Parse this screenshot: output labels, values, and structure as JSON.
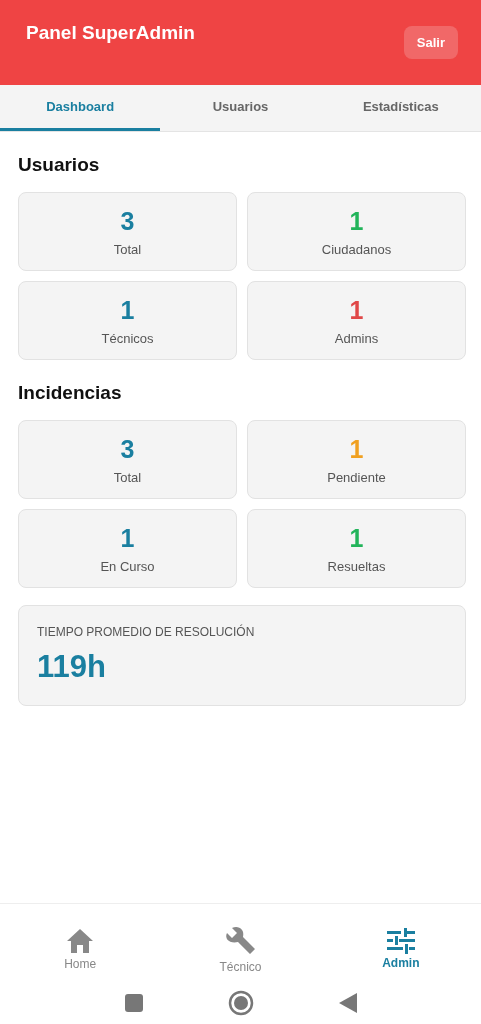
{
  "header": {
    "title": "Panel SuperAdmin",
    "button": "Salir"
  },
  "tabs": [
    {
      "label": "Dashboard",
      "selected": true
    },
    {
      "label": "Usuarios",
      "selected": false
    },
    {
      "label": "Estadísticas",
      "selected": false
    }
  ],
  "sections": [
    {
      "title": "Usuarios",
      "stats": [
        {
          "value": "3",
          "label": "Total",
          "color": "#1a7fa0"
        },
        {
          "value": "1",
          "label": "Ciudadanos",
          "color": "#22b45a"
        },
        {
          "value": "1",
          "label": "Técnicos",
          "color": "#1a7fa0"
        },
        {
          "value": "1",
          "label": "Admins",
          "color": "#e04848"
        }
      ]
    },
    {
      "title": "Incidencias",
      "stats": [
        {
          "value": "3",
          "label": "Total",
          "color": "#1a7fa0"
        },
        {
          "value": "1",
          "label": "Pendiente",
          "color": "#f0a020"
        },
        {
          "value": "1",
          "label": "En Curso",
          "color": "#1a7fa0"
        },
        {
          "value": "1",
          "label": "Resueltas",
          "color": "#22b45a"
        }
      ]
    }
  ],
  "average": {
    "label": "TIEMPO PROMEDIO DE RESOLUCIÓN",
    "value": "119h"
  },
  "bottom_nav": [
    {
      "kind": "home",
      "label": "Home",
      "selected": false
    },
    {
      "kind": "wrench",
      "label": "Técnico",
      "selected": false
    },
    {
      "kind": "sliders",
      "label": "Admin",
      "selected": true
    }
  ]
}
